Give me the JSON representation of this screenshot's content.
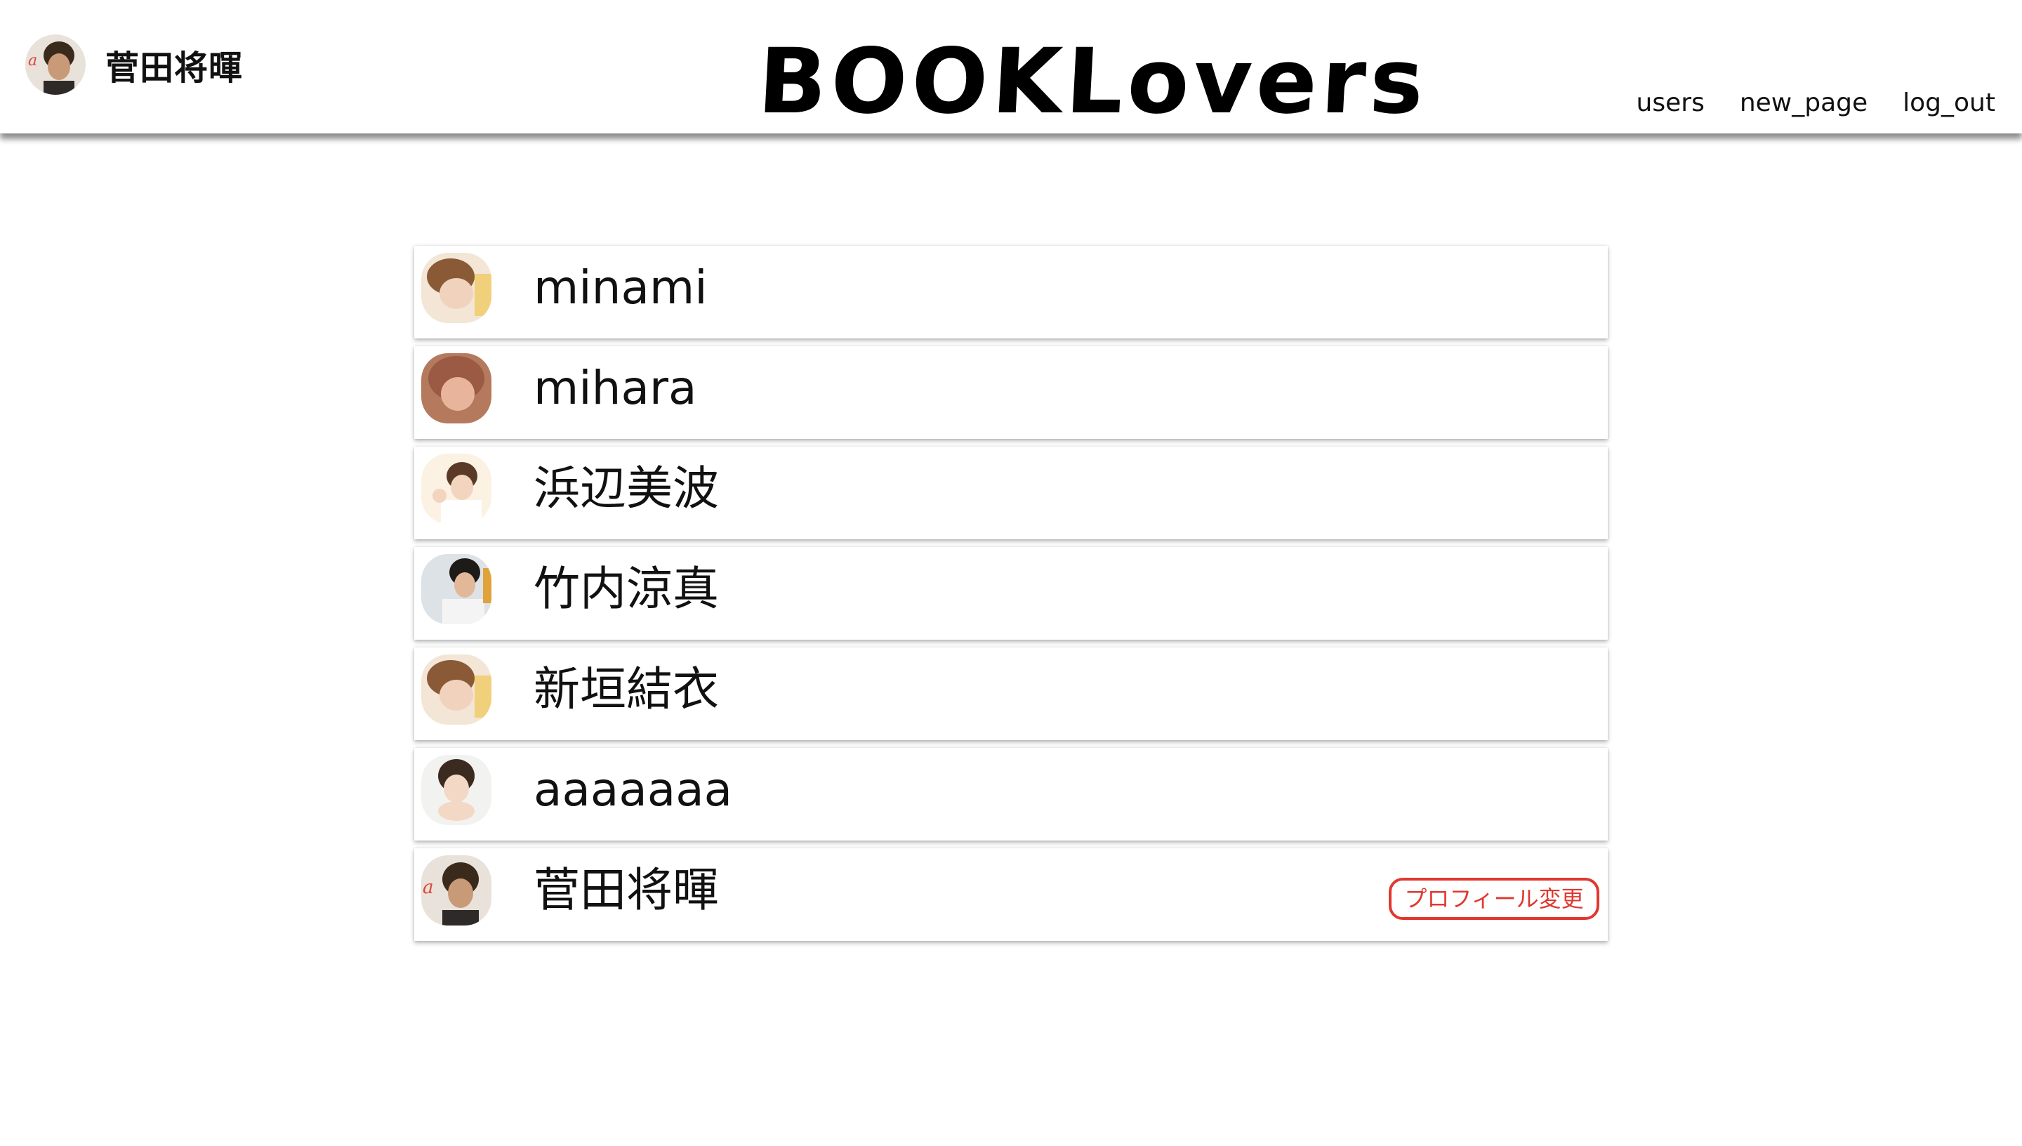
{
  "header": {
    "current_user": "菅田将暉",
    "logo": "BOOKLovers",
    "nav": [
      {
        "label": "users"
      },
      {
        "label": "new_page"
      },
      {
        "label": "log_out"
      }
    ]
  },
  "users": [
    {
      "name": "minami",
      "avatar": "photo-avatar-icon"
    },
    {
      "name": "mihara",
      "avatar": "photo-avatar-icon"
    },
    {
      "name": "浜辺美波",
      "avatar": "photo-avatar-icon"
    },
    {
      "name": "竹内涼真",
      "avatar": "photo-avatar-icon"
    },
    {
      "name": "新垣結衣",
      "avatar": "photo-avatar-icon"
    },
    {
      "name": "aaaaaaa",
      "avatar": "photo-avatar-icon"
    },
    {
      "name": "菅田将暉",
      "avatar": "photo-avatar-icon",
      "edit_label": "プロフィール変更"
    }
  ],
  "colors": {
    "accent": "#e0382f",
    "text": "#111111"
  }
}
